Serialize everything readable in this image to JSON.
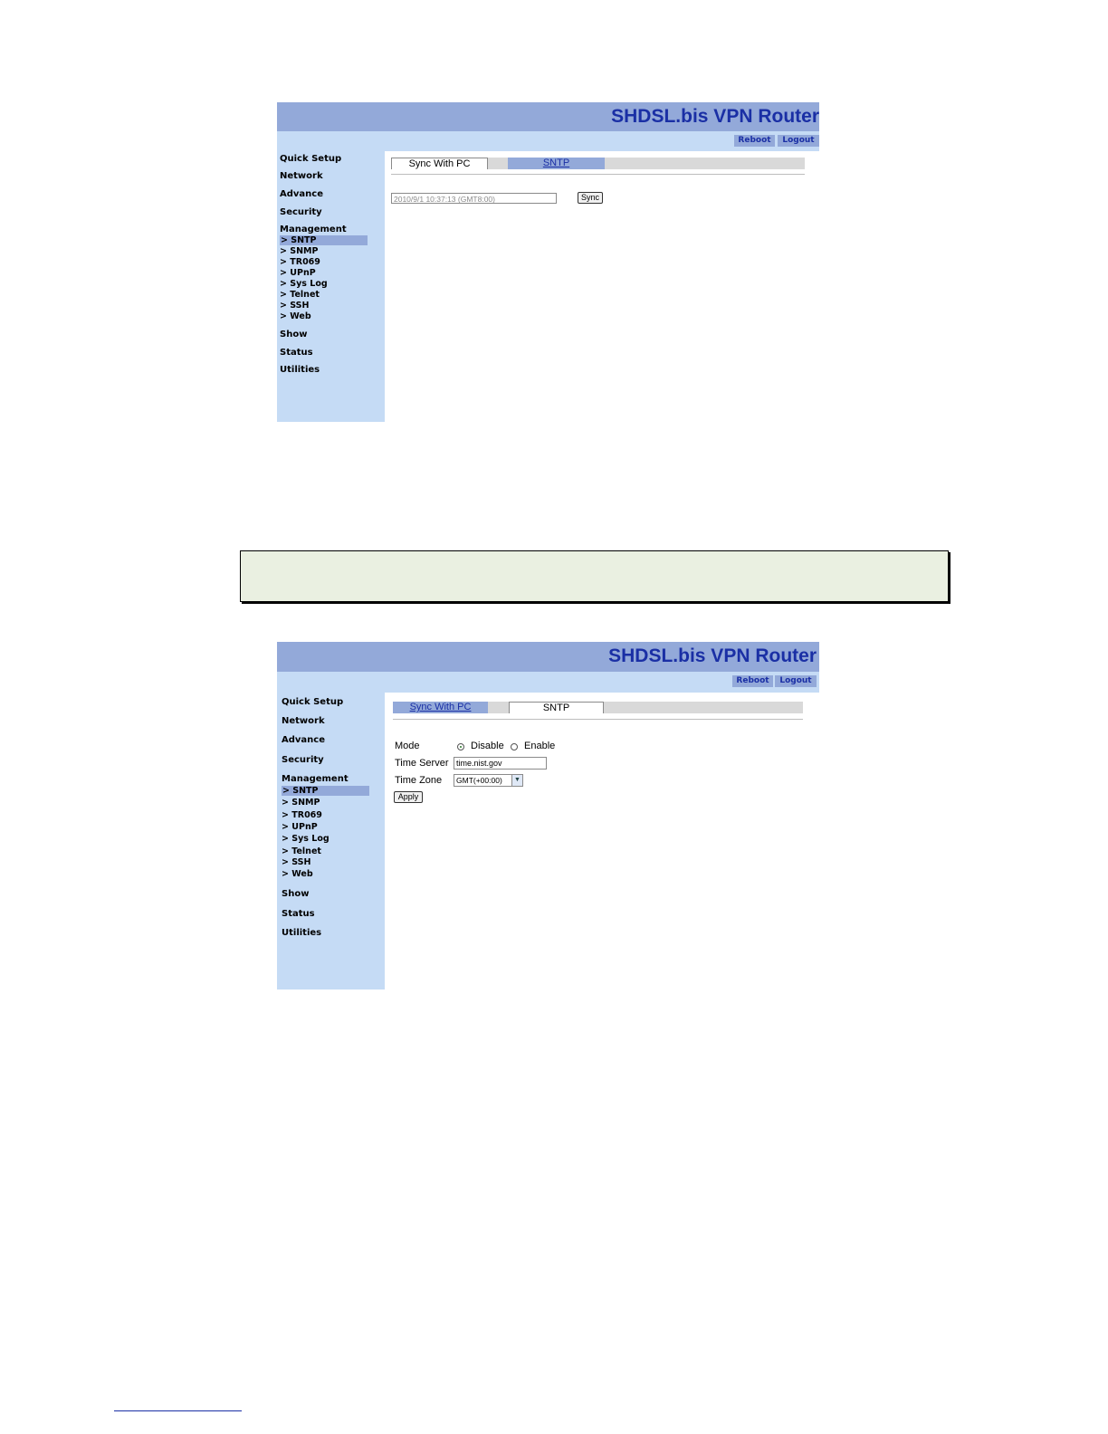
{
  "router_title": "SHDSL.bis VPN Router",
  "top_buttons": {
    "reboot": "Reboot",
    "logout": "Logout"
  },
  "nav": {
    "quick_setup": "Quick Setup",
    "network": "Network",
    "advance": "Advance",
    "security": "Security",
    "management": "Management",
    "management_items": [
      "> SNTP",
      "> SNMP",
      "> TR069",
      "> UPnP",
      "> Sys Log",
      "> Telnet",
      "> SSH",
      "> Web"
    ],
    "show": "Show",
    "status": "Status",
    "utilities": "Utilities"
  },
  "tabs": {
    "sync_with_pc": "Sync With PC",
    "sntp": "SNTP"
  },
  "sync_panel": {
    "datetime_value": "2010/9/1 10:37:13 (GMT8:00)",
    "sync_button": "Sync"
  },
  "sntp_panel": {
    "mode_label": "Mode",
    "mode_options": [
      "Disable",
      "Enable"
    ],
    "mode_selected": "Disable",
    "time_server_label": "Time Server",
    "time_server_value": "time.nist.gov",
    "time_zone_label": "Time Zone",
    "time_zone_value": "GMT(+00:00)",
    "apply_button": "Apply"
  }
}
